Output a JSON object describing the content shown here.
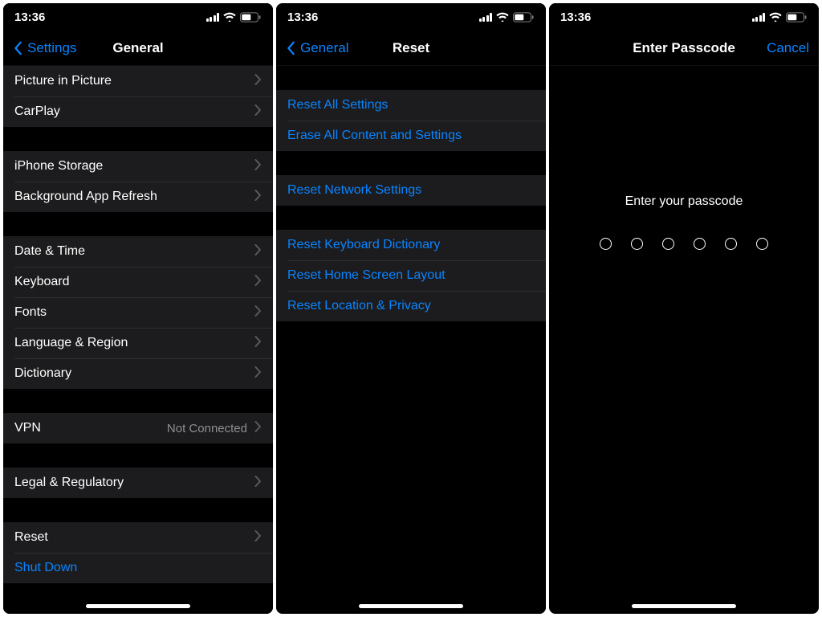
{
  "status": {
    "time": "13:36"
  },
  "screen1": {
    "back": "Settings",
    "title": "General",
    "groups": [
      {
        "rows": [
          {
            "label": "Picture in Picture",
            "disclosure": true
          },
          {
            "label": "CarPlay",
            "disclosure": true
          }
        ]
      },
      {
        "rows": [
          {
            "label": "iPhone Storage",
            "disclosure": true
          },
          {
            "label": "Background App Refresh",
            "disclosure": true
          }
        ]
      },
      {
        "rows": [
          {
            "label": "Date & Time",
            "disclosure": true
          },
          {
            "label": "Keyboard",
            "disclosure": true
          },
          {
            "label": "Fonts",
            "disclosure": true
          },
          {
            "label": "Language & Region",
            "disclosure": true
          },
          {
            "label": "Dictionary",
            "disclosure": true
          }
        ]
      },
      {
        "rows": [
          {
            "label": "VPN",
            "value": "Not Connected",
            "disclosure": true
          }
        ]
      },
      {
        "rows": [
          {
            "label": "Legal & Regulatory",
            "disclosure": true
          }
        ]
      },
      {
        "rows": [
          {
            "label": "Reset",
            "disclosure": true
          },
          {
            "label": "Shut Down",
            "link": true
          }
        ]
      }
    ]
  },
  "screen2": {
    "back": "General",
    "title": "Reset",
    "groups": [
      {
        "rows": [
          {
            "label": "Reset All Settings"
          },
          {
            "label": "Erase All Content and Settings"
          }
        ]
      },
      {
        "rows": [
          {
            "label": "Reset Network Settings"
          }
        ]
      },
      {
        "rows": [
          {
            "label": "Reset Keyboard Dictionary"
          },
          {
            "label": "Reset Home Screen Layout"
          },
          {
            "label": "Reset Location & Privacy"
          }
        ]
      }
    ]
  },
  "screen3": {
    "title": "Enter Passcode",
    "cancel": "Cancel",
    "prompt": "Enter your passcode",
    "digits": 6
  }
}
